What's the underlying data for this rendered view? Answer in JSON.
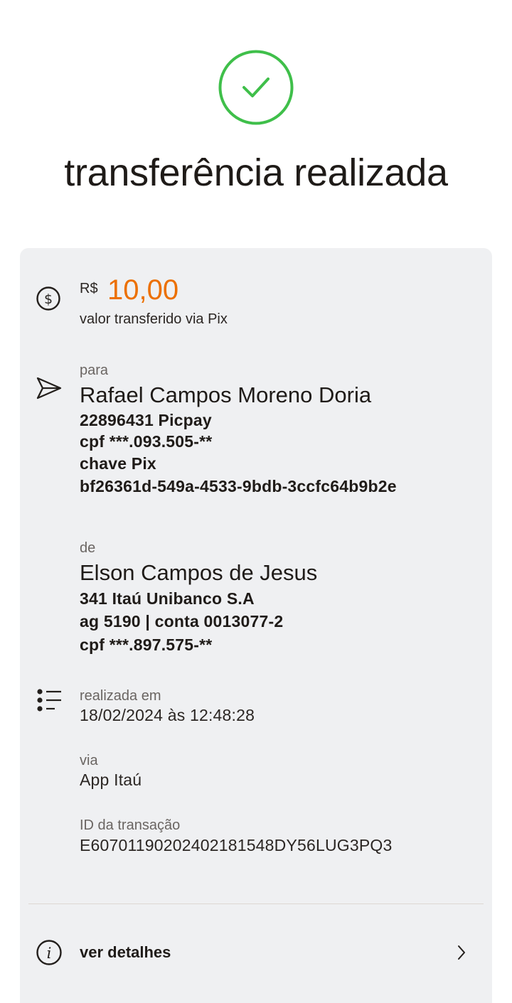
{
  "status": {
    "title": "transferência realizada",
    "icon": "check-circle-icon",
    "accent_color": "#3fbf4a"
  },
  "amount": {
    "currency": "R$",
    "value": "10,00",
    "caption": "valor transferido via Pix",
    "color": "#ec7000",
    "icon": "dollar-circle-icon"
  },
  "recipient": {
    "label": "para",
    "name": "Rafael Campos Moreno Doria",
    "bank": "22896431 Picpay",
    "cpf": "cpf ***.093.505-**",
    "key_label": "chave Pix",
    "key_value": "bf26361d-549a-4533-9bdb-3ccfc64b9b2e",
    "icon": "send-icon"
  },
  "sender": {
    "label": "de",
    "name": "Elson Campos de Jesus",
    "bank": "341 Itaú Unibanco S.A",
    "account": "ag 5190 | conta 0013077-2",
    "cpf": "cpf ***.897.575-**"
  },
  "info": {
    "icon": "list-icon",
    "date_label": "realizada em",
    "date_value": "18/02/2024 às 12:48:28",
    "via_label": "via",
    "via_value": "App Itaú",
    "id_label": "ID da transação",
    "id_value": "E60701190202402181548DY56LUG3PQ3"
  },
  "details_link": {
    "label": "ver detalhes",
    "icon": "info-icon",
    "arrow_icon": "chevron-right-icon"
  }
}
